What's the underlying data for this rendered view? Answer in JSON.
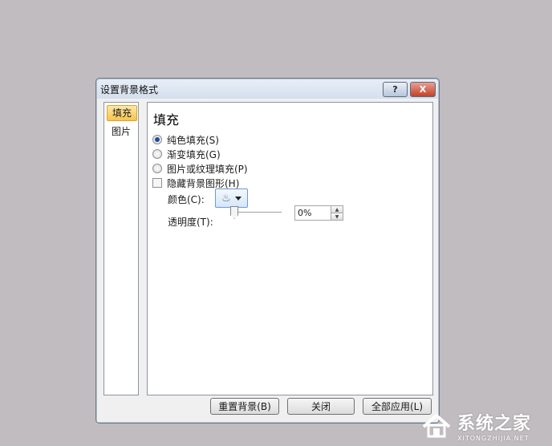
{
  "dialog": {
    "title": "设置背景格式",
    "help_label": "?",
    "close_label": "X"
  },
  "nav": {
    "items": [
      {
        "label": "填充",
        "selected": true
      },
      {
        "label": "图片",
        "selected": false
      }
    ]
  },
  "fill": {
    "heading": "填充",
    "options": [
      {
        "label": "纯色填充(S)",
        "checked": true
      },
      {
        "label": "渐变填充(G)",
        "checked": false
      },
      {
        "label": "图片或纹理填充(P)",
        "checked": false
      }
    ],
    "hide_background_graphics": {
      "label": "隐藏背景图形(H)",
      "checked": false
    },
    "color": {
      "label": "颜色(C):",
      "icon": "paint-bucket-icon"
    },
    "transparency": {
      "label": "透明度(T):",
      "value": "0%",
      "slider_fraction": 0
    }
  },
  "footer": {
    "reset_label": "重置背景(B)",
    "close_label": "关闭",
    "apply_all_label": "全部应用(L)"
  },
  "watermark": {
    "brand": "系统之家",
    "domain": "XITONGZHIJIA.NET"
  }
}
